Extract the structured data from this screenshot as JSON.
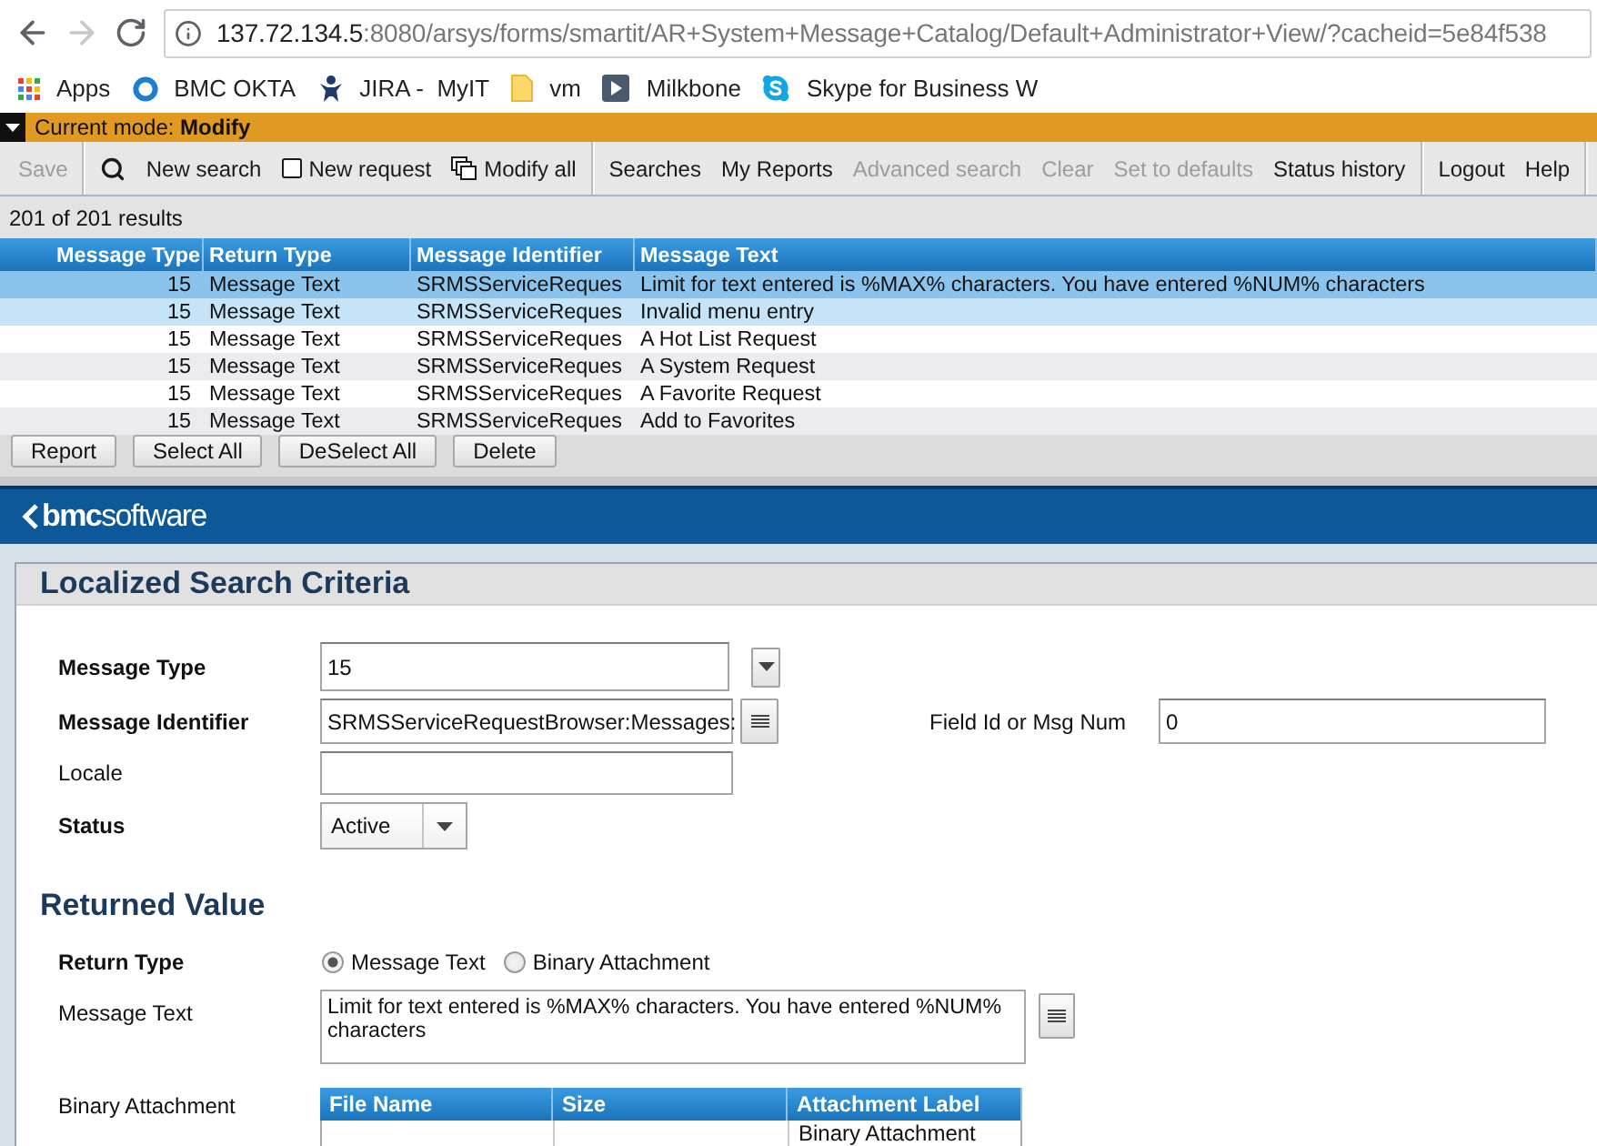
{
  "browser": {
    "nav": [
      {
        "kind": "back",
        "disabled": false
      },
      {
        "kind": "forward",
        "disabled": true
      },
      {
        "kind": "reload",
        "disabled": false
      }
    ],
    "url_host": "137.72.134.5",
    "url_path": ":8080/arsys/forms/smartit/AR+System+Message+Catalog/Default+Administrator+View/?cacheid=5e84f538"
  },
  "bookmarks": [
    {
      "kind": "apps",
      "label": "Apps"
    },
    {
      "kind": "ring",
      "label": "BMC OKTA"
    },
    {
      "kind": "figure",
      "label": "JIRA -  MyIT"
    },
    {
      "kind": "note",
      "label": "vm"
    },
    {
      "kind": "play",
      "label": "Milkbone"
    },
    {
      "kind": "bubble",
      "label": "Skype for Business W"
    }
  ],
  "mode_bar": {
    "text": "Current mode: **Modify**"
  },
  "toolbar": {
    "groups": [
      [
        {
          "kind": "text",
          "label": "Save",
          "disabled": true
        }
      ],
      [
        {
          "kind": "search",
          "disabled": false
        },
        {
          "kind": "text",
          "label": "New search",
          "disabled": false
        },
        {
          "kind": "page",
          "label": "New request",
          "disabled": false
        },
        {
          "kind": "windows",
          "label": "Modify all",
          "disabled": false
        }
      ],
      [
        {
          "kind": "text",
          "label": "Searches",
          "disabled": false
        },
        {
          "kind": "text",
          "label": "My Reports",
          "disabled": false
        },
        {
          "kind": "text",
          "label": "Advanced search",
          "disabled": true
        },
        {
          "kind": "text",
          "label": "Clear",
          "disabled": true
        },
        {
          "kind": "text",
          "label": "Set to defaults",
          "disabled": true
        },
        {
          "kind": "text",
          "label": "Status history",
          "disabled": false
        }
      ],
      [
        {
          "kind": "text",
          "label": "Logout",
          "disabled": false
        },
        {
          "kind": "text",
          "label": "Help",
          "disabled": false
        }
      ]
    ]
  },
  "results": {
    "count": "201 of 201 results",
    "columns": [
      "Message Type",
      "Return Type",
      "Message Identifier",
      "Message Text"
    ],
    "rows": [
      {
        "cells": [
          "15",
          "Message Text",
          "SRMSServiceReques",
          "Limit for text entered is %MAX% characters. You have entered %NUM% characters"
        ],
        "selected": true,
        "highlighted": false
      },
      {
        "cells": [
          "15",
          "Message Text",
          "SRMSServiceReques",
          "Invalid menu entry"
        ],
        "selected": false,
        "highlighted": true
      },
      {
        "cells": [
          "15",
          "Message Text",
          "SRMSServiceReques",
          "A Hot List Request"
        ],
        "selected": false,
        "highlighted": false
      },
      {
        "cells": [
          "15",
          "Message Text",
          "SRMSServiceReques",
          "A System Request"
        ],
        "selected": false,
        "highlighted": false
      },
      {
        "cells": [
          "15",
          "Message Text",
          "SRMSServiceReques",
          "A Favorite Request"
        ],
        "selected": false,
        "highlighted": false
      },
      {
        "cells": [
          "15",
          "Message Text",
          "SRMSServiceReques",
          "Add to Favorites"
        ],
        "selected": false,
        "highlighted": false
      }
    ]
  },
  "actions": [
    "Report",
    "Select All",
    "DeSelect All",
    "Delete"
  ],
  "banner": {
    "logo": "**bmc**software"
  },
  "search_criteria": {
    "title": "Localized Search Criteria",
    "fields": [
      {
        "label": "Message Type",
        "required": true,
        "kind": "dropdown",
        "value": "15"
      },
      {
        "label": "Message Identifier",
        "required": true,
        "kind": "menu",
        "value": "SRMSServiceRequestBrowser:Messages:"
      },
      {
        "label": "Locale",
        "required": false,
        "kind": "text"
      },
      {
        "label": "Status",
        "required": true,
        "kind": "select",
        "value": "Active"
      }
    ],
    "side_field": {
      "label": "Field Id or Msg Num",
      "value": "0"
    }
  },
  "returned_value": {
    "title": "Returned Value",
    "return_type": {
      "label": "Return Type",
      "required": true,
      "options": [
        {
          "label": "Message Text",
          "selected": true
        },
        {
          "label": "Binary Attachment",
          "selected": false
        }
      ]
    },
    "message_text": {
      "label": "Message Text",
      "required": false,
      "value": "Limit for text entered is %MAX% characters. You have entered %NUM% characters"
    },
    "attachments": {
      "label": "Binary Attachment",
      "required": false,
      "columns": [
        "File Name",
        "Size",
        "Attachment Label"
      ],
      "rows": [
        {
          "attachment_label": "Binary Attachment"
        }
      ]
    }
  }
}
